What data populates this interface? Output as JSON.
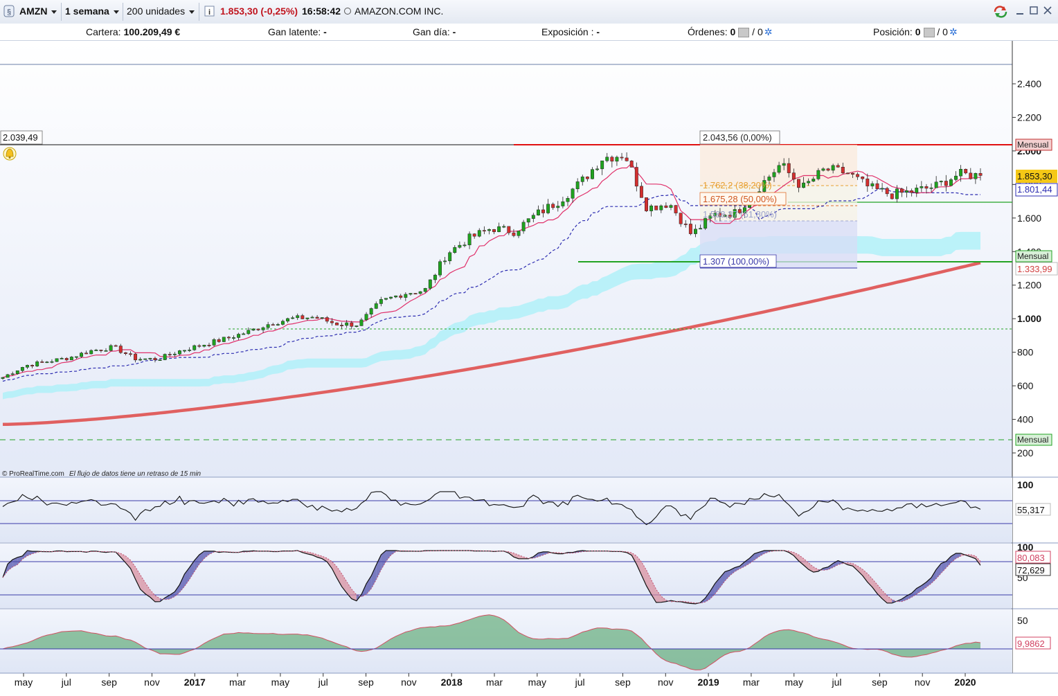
{
  "toolbar": {
    "symbol": "AMZN",
    "timeframe": "1 semana",
    "units": "200 unidades",
    "quote": "1.853,30 (-0,25%)",
    "time": "16:58:42",
    "instrument": "AMAZON.COM INC."
  },
  "infobar": {
    "portfolio_label": "Cartera:",
    "portfolio_value": "100.209,49 €",
    "unrealized_label": "Gan latente:",
    "unrealized_value": "-",
    "daily_label": "Gan día:",
    "daily_value": "-",
    "exposure_label": "Exposición :",
    "exposure_value": "-",
    "orders_label": "Órdenes:",
    "orders_value": "0",
    "orders_value2": "/ 0",
    "position_label": "Posición:",
    "position_value": "0",
    "position_value2": "/ 0"
  },
  "colors": {
    "bull": "#1fa31f",
    "bear": "#d32f2f",
    "ma_long": "#e06060",
    "tenkan": "#e0306a",
    "kijun": "#2b2bb0",
    "cloud": "#a8f0f8",
    "resistance": "#e01010",
    "support": "#22a322"
  },
  "price_axis": {
    "ticks": [
      "2.400",
      "2.200",
      "2.000",
      "1.800",
      "1.600",
      "1.400",
      "1.200",
      "1.000",
      "800",
      "600",
      "400",
      "200"
    ]
  },
  "labels": {
    "left_price": "2.039,49",
    "fib_0": "2.043,56 (0,00%)",
    "fib_382": "1.762,2 (38,20%)",
    "fib_50": "1.675,28 (50,00%)",
    "fib_618": "1.588,37 (61,80%)",
    "fib_100": "1.307 (100,00%)",
    "monthly_top": "Mensual",
    "monthly_mid": "Mensual",
    "monthly_low": "Mensual",
    "current_price": "1.853,30",
    "kijun_value": "1.801,44",
    "ma_value": "1.333,99",
    "credit": "© ProRealTime.com",
    "delay_note": "El flujo de datos tiene un retraso de 15 min"
  },
  "indicators": {
    "panel1_top": "100",
    "panel1_value": "55,317",
    "panel2_top": "100",
    "panel2_mid": "50",
    "panel2_value_a": "80,083",
    "panel2_value_b": "72,629",
    "panel3_top": "50",
    "panel3_value": "9,9862"
  },
  "time_axis": [
    "may",
    "jul",
    "sep",
    "nov",
    "2017",
    "mar",
    "may",
    "jul",
    "sep",
    "nov",
    "2018",
    "mar",
    "may",
    "jul",
    "sep",
    "nov",
    "2019",
    "mar",
    "may",
    "jul",
    "sep",
    "nov",
    "2020"
  ],
  "chart_data": {
    "type": "candlestick",
    "timeframe": "1 semana",
    "y_range": [
      100,
      2500
    ],
    "weekly_close_path": [
      {
        "d": "2016-05",
        "c": 650
      },
      {
        "d": "2016-06",
        "c": 720
      },
      {
        "d": "2016-07",
        "c": 745
      },
      {
        "d": "2016-08",
        "c": 768
      },
      {
        "d": "2016-09",
        "c": 810
      },
      {
        "d": "2016-10",
        "c": 830
      },
      {
        "d": "2016-11",
        "c": 760
      },
      {
        "d": "2016-12",
        "c": 760
      },
      {
        "d": "2017-01",
        "c": 810
      },
      {
        "d": "2017-02",
        "c": 845
      },
      {
        "d": "2017-03",
        "c": 880
      },
      {
        "d": "2017-04",
        "c": 920
      },
      {
        "d": "2017-05",
        "c": 970
      },
      {
        "d": "2017-06",
        "c": 1000
      },
      {
        "d": "2017-07",
        "c": 1010
      },
      {
        "d": "2017-08",
        "c": 970
      },
      {
        "d": "2017-09",
        "c": 965
      },
      {
        "d": "2017-10",
        "c": 1100
      },
      {
        "d": "2017-11",
        "c": 1150
      },
      {
        "d": "2017-12",
        "c": 1170
      },
      {
        "d": "2018-01",
        "c": 1390
      },
      {
        "d": "2018-02",
        "c": 1480
      },
      {
        "d": "2018-03",
        "c": 1540
      },
      {
        "d": "2018-04",
        "c": 1520
      },
      {
        "d": "2018-05",
        "c": 1620
      },
      {
        "d": "2018-06",
        "c": 1700
      },
      {
        "d": "2018-07",
        "c": 1810
      },
      {
        "d": "2018-08",
        "c": 1960
      },
      {
        "d": "2018-09",
        "c": 1980
      },
      {
        "d": "2018-10",
        "c": 1660
      },
      {
        "d": "2018-11",
        "c": 1690
      },
      {
        "d": "2018-12",
        "c": 1500
      },
      {
        "d": "2019-01",
        "c": 1620
      },
      {
        "d": "2019-02",
        "c": 1630
      },
      {
        "d": "2019-03",
        "c": 1780
      },
      {
        "d": "2019-04",
        "c": 1920
      },
      {
        "d": "2019-05",
        "c": 1780
      },
      {
        "d": "2019-06",
        "c": 1890
      },
      {
        "d": "2019-07",
        "c": 1870
      },
      {
        "d": "2019-08",
        "c": 1780
      },
      {
        "d": "2019-09",
        "c": 1740
      },
      {
        "d": "2019-10",
        "c": 1760
      },
      {
        "d": "2019-11",
        "c": 1790
      },
      {
        "d": "2019-12",
        "c": 1860
      },
      {
        "d": "2020-01",
        "c": 1853.3
      }
    ],
    "fibonacci": [
      {
        "level": "0,00%",
        "price": 2043.56
      },
      {
        "level": "38,20%",
        "price": 1762.2
      },
      {
        "level": "50,00%",
        "price": 1675.28
      },
      {
        "level": "61,80%",
        "price": 1588.37
      },
      {
        "level": "100,00%",
        "price": 1307
      }
    ],
    "horizontal_lines": [
      {
        "price": 2039.49,
        "color": "black"
      },
      {
        "price": 2043.56,
        "color": "red",
        "label": "Mensual"
      },
      {
        "price": 1333.99,
        "color": "green",
        "label": "Mensual"
      },
      {
        "price": 940,
        "color": "green",
        "style": "dotted"
      },
      {
        "price": 280,
        "color": "green",
        "style": "dashed",
        "label": "Mensual"
      }
    ],
    "last_price": 1853.3,
    "kijun": 1801.44,
    "long_ma": 1333.99,
    "oscillators": [
      {
        "name": "panel-1",
        "last": 55.317
      },
      {
        "name": "panel-2",
        "last": [
          80.083,
          72.629
        ]
      },
      {
        "name": "panel-3",
        "last": 9.9862
      }
    ]
  }
}
